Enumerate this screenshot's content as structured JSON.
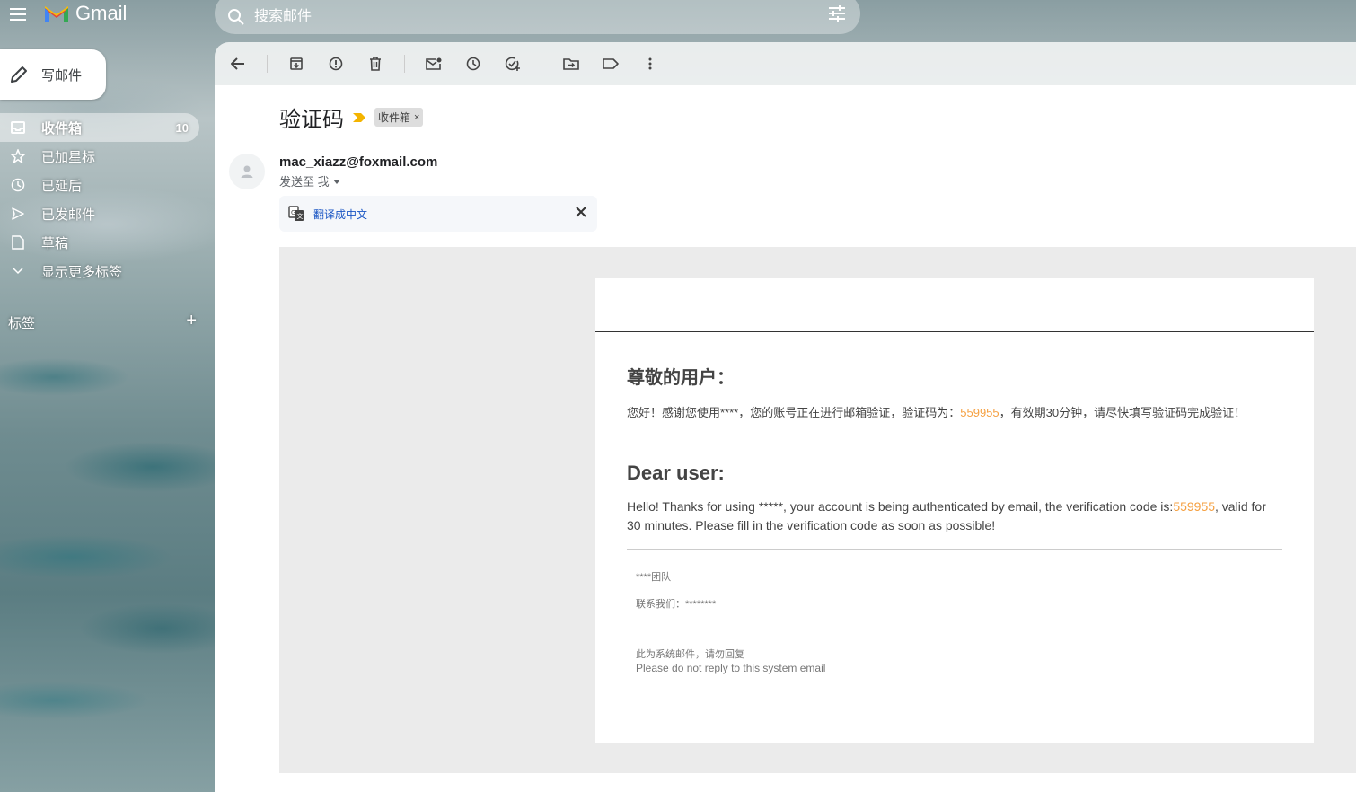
{
  "app": {
    "name": "Gmail"
  },
  "search": {
    "placeholder": "搜索邮件"
  },
  "compose": {
    "label": "写邮件"
  },
  "sidebar": {
    "items": [
      {
        "label": "收件箱",
        "count": "10",
        "icon": "inbox-icon",
        "active": true
      },
      {
        "label": "已加星标",
        "icon": "star-icon"
      },
      {
        "label": "已延后",
        "icon": "clock-icon"
      },
      {
        "label": "已发邮件",
        "icon": "send-icon"
      },
      {
        "label": "草稿",
        "icon": "draft-icon"
      },
      {
        "label": "显示更多标签",
        "icon": "chevron-down-icon"
      }
    ],
    "labels_heading": "标签",
    "add_label": "+"
  },
  "toolbar": {
    "icons": [
      "back-icon",
      "archive-icon",
      "report-spam-icon",
      "delete-icon",
      "mark-unread-icon",
      "snooze-icon",
      "add-task-icon",
      "move-to-icon",
      "label-icon",
      "more-icon"
    ]
  },
  "message": {
    "subject": "验证码",
    "label_chip": "收件箱",
    "label_chip_close": "×",
    "sender": "mac_xiazz@foxmail.com",
    "to": "发送至 我",
    "translate_link": "翻译成中文"
  },
  "email_body": {
    "greeting_cn": "尊敬的用户：",
    "para_cn_before": "您好！感谢您使用****，您的账号正在进行邮箱验证，验证码为：",
    "code": "559955",
    "para_cn_after": "，有效期30分钟，请尽快填写验证码完成验证！",
    "greeting_en": "Dear user:",
    "para_en_before": "Hello! Thanks for using *****, your account is being authenticated by email, the verification code is:",
    "para_en_after": ", valid for 30 minutes. Please fill in the verification code as soon as possible!",
    "team": "****团队",
    "contact": "联系我们：********",
    "system_cn": "此为系统邮件，请勿回复",
    "system_en": "Please do not reply to this system email"
  },
  "colors": {
    "code": "#f5a041",
    "translate_link": "#1a56c4"
  }
}
